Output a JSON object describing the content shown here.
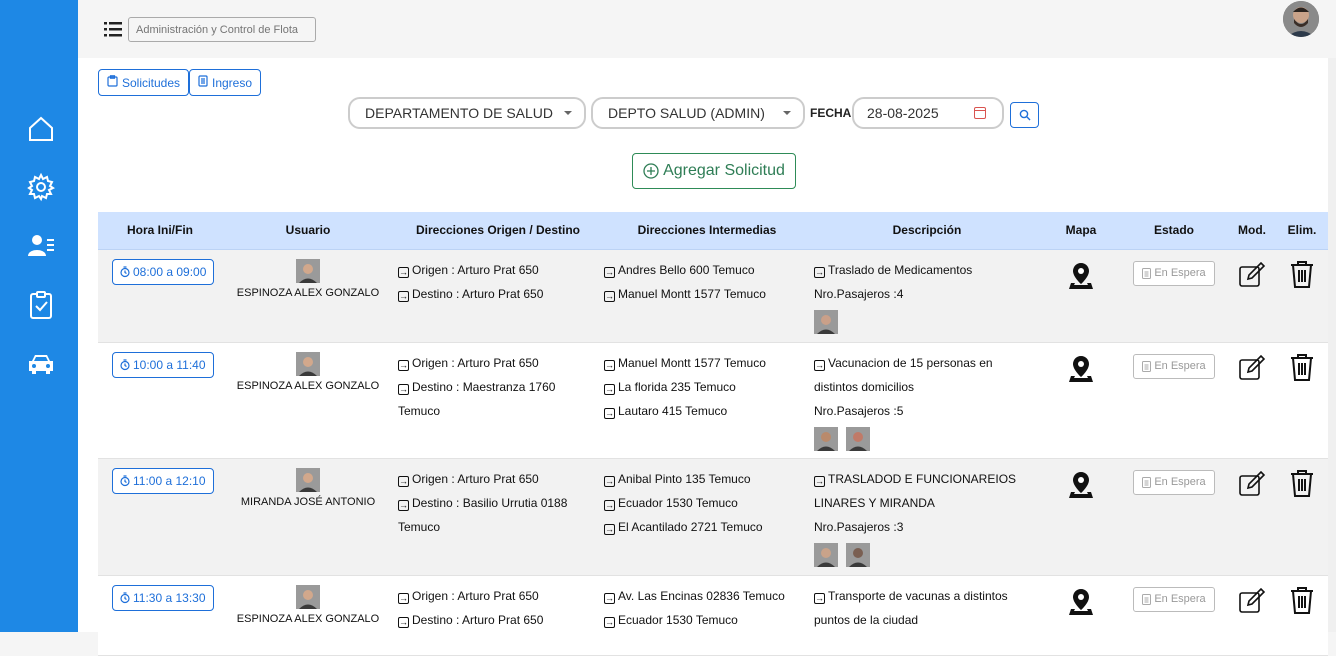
{
  "app": {
    "brand_placeholder": "Administración y Control de Flota"
  },
  "sidebar": {
    "items": [
      {
        "icon": "home-icon"
      },
      {
        "icon": "gear-icon"
      },
      {
        "icon": "users-list-icon"
      },
      {
        "icon": "clipboard-check-icon"
      },
      {
        "icon": "car-icon"
      }
    ]
  },
  "toolbar": {
    "solicitudes_label": "Solicitudes",
    "ingreso_label": "Ingreso"
  },
  "filters": {
    "department": "DEPARTAMENTO DE SALUD",
    "sub_department": "DEPTO SALUD (ADMIN)",
    "fecha_label": "FECHA",
    "fecha_value": "28-08-2025"
  },
  "add_button_label": "Agregar Solicitud",
  "table": {
    "headers": [
      "Hora Ini/Fin",
      "Usuario",
      "Direcciones Origen / Destino",
      "Direcciones Intermedias",
      "Descripción",
      "Mapa",
      "Estado",
      "Mod.",
      "Elim."
    ],
    "rows": [
      {
        "time": "08:00 a 09:00",
        "user": "ESPINOZA ALEX GONZALO",
        "origen": "Origen : Arturo Prat 650",
        "destino": "Destino : Arturo Prat 650",
        "destino_extra": "",
        "intermedias": [
          "Andres Bello 600 Temuco",
          "Manuel Montt 1577 Temuco"
        ],
        "descripcion": [
          "Traslado de Medicamentos"
        ],
        "pasajeros": "Nro.Pasajeros :4",
        "pax_avatars": 1,
        "estado": "En Espera"
      },
      {
        "time": "10:00 a 11:40",
        "user": "ESPINOZA ALEX GONZALO",
        "origen": "Origen : Arturo Prat 650",
        "destino": "Destino : Maestranza 1760",
        "destino_extra": "Temuco",
        "intermedias": [
          "Manuel Montt 1577 Temuco",
          "La florida 235 Temuco",
          "Lautaro 415 Temuco"
        ],
        "descripcion": [
          "Vacunacion de 15 personas en",
          "distintos domicilios"
        ],
        "pasajeros": "Nro.Pasajeros :5",
        "pax_avatars": 2,
        "estado": "En Espera"
      },
      {
        "time": "11:00 a 12:10",
        "user": "MIRANDA JOSÉ ANTONIO",
        "origen": "Origen : Arturo Prat 650",
        "destino": "Destino : Basilio Urrutia 0188",
        "destino_extra": "Temuco",
        "intermedias": [
          "Anibal Pinto 135 Temuco",
          "Ecuador 1530 Temuco",
          "El Acantilado 2721 Temuco"
        ],
        "descripcion": [
          "TRASLADOD E FUNCIONAREIOS",
          "LINARES Y MIRANDA"
        ],
        "pasajeros": "Nro.Pasajeros :3",
        "pax_avatars": 2,
        "estado": "En Espera"
      },
      {
        "time": "11:30 a 13:30",
        "user": "ESPINOZA ALEX GONZALO",
        "origen": "Origen : Arturo Prat 650",
        "destino": "Destino : Arturo Prat 650",
        "destino_extra": "",
        "intermedias": [
          "Av. Las Encinas 02836 Temuco",
          "Ecuador 1530 Temuco"
        ],
        "descripcion": [
          "Transporte de vacunas a distintos",
          "puntos de la ciudad"
        ],
        "pasajeros": "",
        "pax_avatars": 0,
        "estado": "En Espera"
      }
    ]
  }
}
